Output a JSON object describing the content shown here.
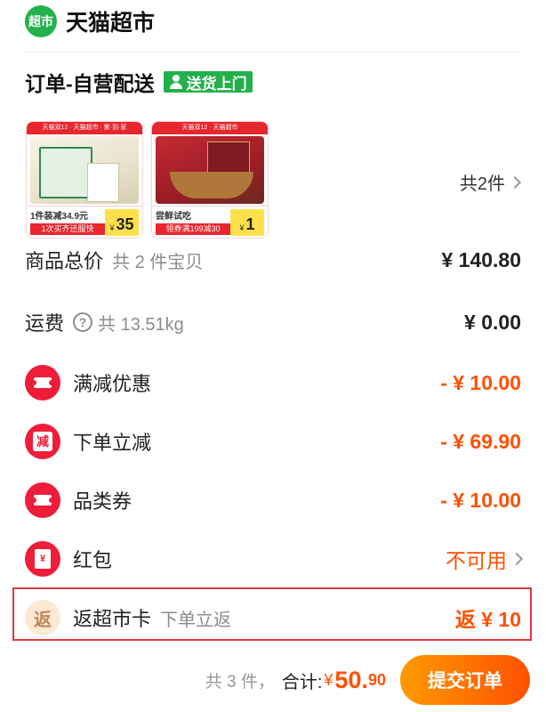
{
  "store": {
    "logo_text": "超市",
    "name": "天猫超市"
  },
  "order": {
    "title": "订单-自营配送",
    "delivery_tag": "送货上门"
  },
  "products": [
    {
      "top_banner": "天猫双12 · 天猫超市 · 紫·到·家",
      "promo_line1": "1件装减34.9元",
      "promo_line2": "1次买齐还服快",
      "price_currency": "¥",
      "price": "35"
    },
    {
      "top_banner": "天猫双12 · 天猫超市",
      "promo_line1": "尝鲜试吃",
      "promo_line2": "领券满199减30",
      "price_currency": "¥",
      "price": "1"
    }
  ],
  "item_count": "共2件",
  "subtotal": {
    "label": "商品总价",
    "sub": "共 2 件宝贝",
    "value": "¥ 140.80"
  },
  "shipping": {
    "label": "运费",
    "help_icon_glyph": "?",
    "sub": "共 13.51kg",
    "value": "¥ 0.00"
  },
  "discounts": [
    {
      "icon": "ticket-icon",
      "label": "满减优惠",
      "value": "- ¥ 10.00"
    },
    {
      "icon": "reduce-icon",
      "icon_glyph": "减",
      "label": "下单立减",
      "value": "- ¥ 69.90"
    },
    {
      "icon": "ticket-icon",
      "label": "品类券",
      "value": "- ¥ 10.00"
    }
  ],
  "red_packet": {
    "icon": "red-envelope-icon",
    "icon_glyph": "¥",
    "label": "红包",
    "value": "不可用"
  },
  "cashback": {
    "icon": "cashback-icon",
    "icon_glyph": "返",
    "label": "返超市卡",
    "sub": "下单立返",
    "value": "返 ¥ 10"
  },
  "footer": {
    "count": "共 3 件，",
    "total_label": "合计:",
    "currency": "¥",
    "amount_int": "50.",
    "amount_dec": "90",
    "submit": "提交订单"
  },
  "colors": {
    "accent": "#ff5000",
    "green": "#22b04b",
    "red": "#ee1d3a",
    "highlight": "#e0393b"
  }
}
